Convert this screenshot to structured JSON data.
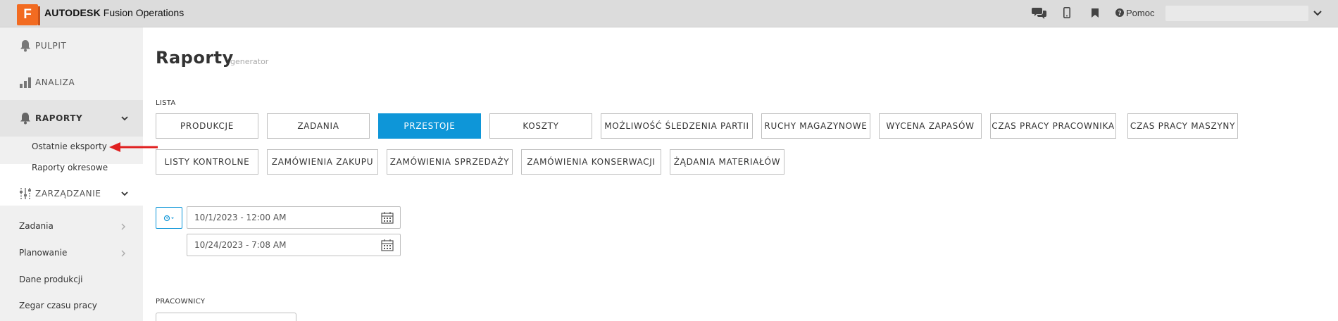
{
  "app": {
    "logo_letter": "F",
    "brand": "AUTODESK",
    "product": "Fusion Operations"
  },
  "topbar": {
    "icons": [
      "chat-icon",
      "mobile-icon",
      "bookmark-icon",
      "help-icon"
    ],
    "help_label": "Pomoc",
    "user_value": ""
  },
  "sidebar": {
    "items": [
      {
        "label": "PULPIT",
        "icon": "bell-icon"
      },
      {
        "label": "ANALIZA",
        "icon": "bar-chart-icon"
      },
      {
        "label": "RAPORTY",
        "icon": "bell-icon",
        "expanded": true
      },
      {
        "label": "ZARZĄDZANIE",
        "icon": "sliders-icon",
        "expanded": true
      }
    ],
    "raporty_sub": [
      "Ostatnie eksporty",
      "Raporty okresowe"
    ],
    "zarzadzanie_sub": [
      "Zadania",
      "Planowanie",
      "Dane produkcji",
      "Zegar czasu pracy"
    ]
  },
  "main": {
    "title": "Raporty",
    "subtitle": "generator",
    "list_label": "LISTA",
    "reports_row1": [
      "PRODUKCJE",
      "ZADANIA",
      "PRZESTOJE",
      "KOSZTY",
      "MOŻLIWOŚĆ ŚLEDZENIA PARTII",
      "RUCHY MAGAZYNOWE",
      "WYCENA ZAPASÓW",
      "CZAS PRACY PRACOWNIKA",
      "CZAS PRACY MASZYNY"
    ],
    "reports_row2": [
      "LISTY KONTROLNE",
      "ZAMÓWIENIA ZAKUPU",
      "ZAMÓWIENIA SPRZEDAŻY",
      "ZAMÓWIENIA KONSERWACJI",
      "ŻĄDANIA MATERIAŁÓW"
    ],
    "active_report": "PRZESTOJE",
    "date_from": "10/1/2023 - 12:00 AM",
    "date_to": "10/24/2023 - 7:08 AM",
    "employees_label": "PRACOWNICY"
  },
  "colors": {
    "accent": "#0e96d8",
    "brand_orange": "#f26b21",
    "annotation_red": "#e02020"
  }
}
